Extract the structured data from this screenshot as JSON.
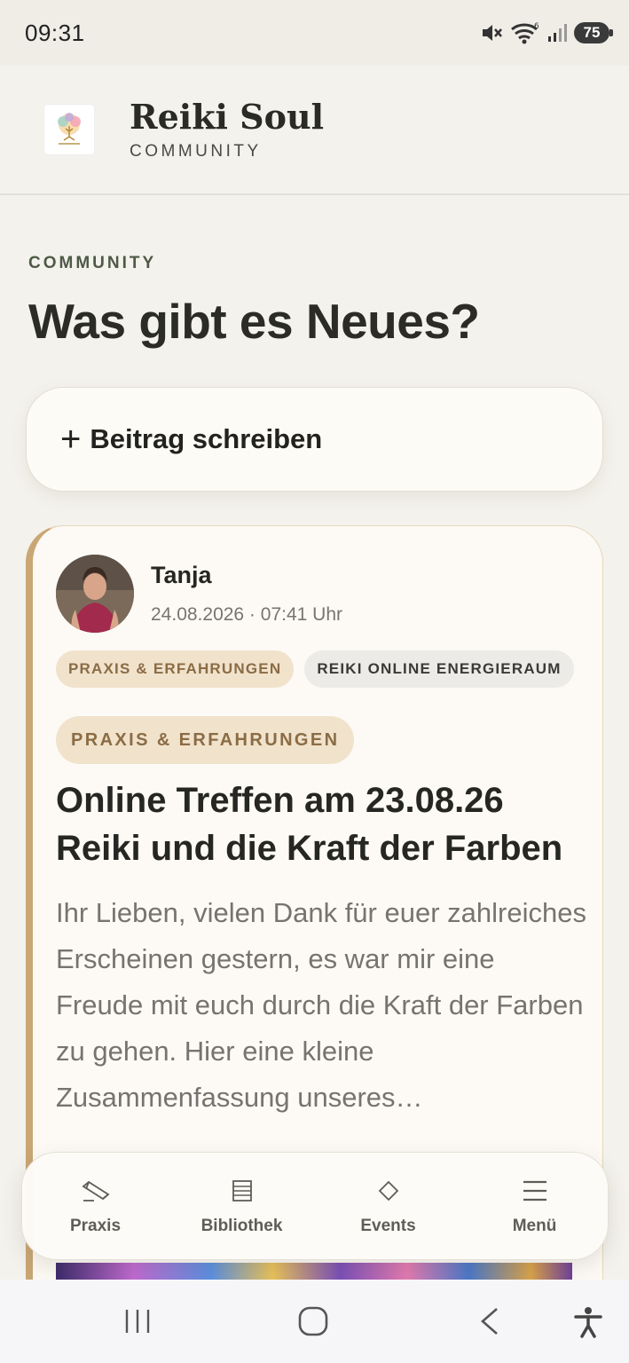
{
  "status_bar": {
    "time": "09:31",
    "battery": "75"
  },
  "header": {
    "title": "Reiki Soul",
    "subtitle": "COMMUNITY"
  },
  "page": {
    "eyebrow": "COMMUNITY",
    "title": "Was gibt es Neues?"
  },
  "compose": {
    "plus": "+",
    "label": "Beitrag schreiben"
  },
  "post": {
    "author": "Tanja",
    "date": "24.08.2026 · 07:41 Uhr",
    "tags": [
      "PRAXIS & ERFAHRUNGEN",
      "REIKI ONLINE ENERGIERAUM"
    ],
    "category": "PRAXIS & ERFAHRUNGEN",
    "title": "Online Treffen am 23.08.26 Reiki und die Kraft der Farben",
    "excerpt": "Ihr Lieben, vielen Dank für euer zahlreiches Erscheinen gestern, es war mir eine Freude mit euch durch die Kraft der Farben zu gehen. Hier eine kleine Zusammenfassung unseres…"
  },
  "bottom_nav": {
    "items": [
      {
        "label": "Praxis",
        "icon": "pencil-icon"
      },
      {
        "label": "Bibliothek",
        "icon": "book-icon"
      },
      {
        "label": "Events",
        "icon": "diamond-icon"
      },
      {
        "label": "Menü",
        "icon": "menu-icon"
      }
    ]
  },
  "colors": {
    "background": "#f4f2ed",
    "accent": "#c9a774",
    "tag_bg": "#f1e2cc",
    "tag_text": "#8a6c45",
    "eyebrow": "#4d5a45"
  }
}
